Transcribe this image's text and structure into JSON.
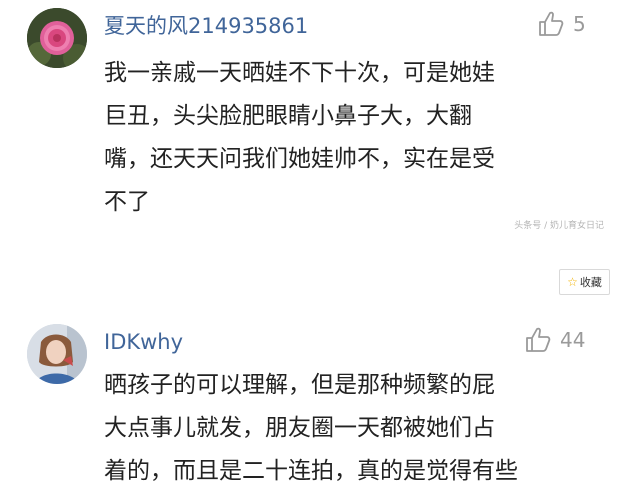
{
  "comments": [
    {
      "username": "夏天的风214935861",
      "likes": "5",
      "lines": [
        "我一亲戚一天晒娃不下十次，可是她娃",
        "巨丑，头尖脸肥眼睛小鼻子大，大翻",
        "嘴，还天天问我们她娃帅不，实在是受",
        "不了"
      ],
      "watermark": "头条号 / 奶儿育女日记",
      "avatar_icon": "pink-flower-avatar"
    },
    {
      "username": "IDKwhy",
      "likes": "44",
      "lines": [
        "晒孩子的可以理解，但是那种频繁的屁",
        "大点事儿就发，朋友圈一天都被她们占",
        "着的，而且是二十连拍，真的是觉得有些"
      ],
      "avatar_icon": "woman-portrait-avatar"
    }
  ],
  "favorite": {
    "label": "收藏",
    "icon": "star-icon"
  },
  "colors": {
    "username": "#406599",
    "text": "#222222",
    "muted": "#9a9a9a"
  }
}
